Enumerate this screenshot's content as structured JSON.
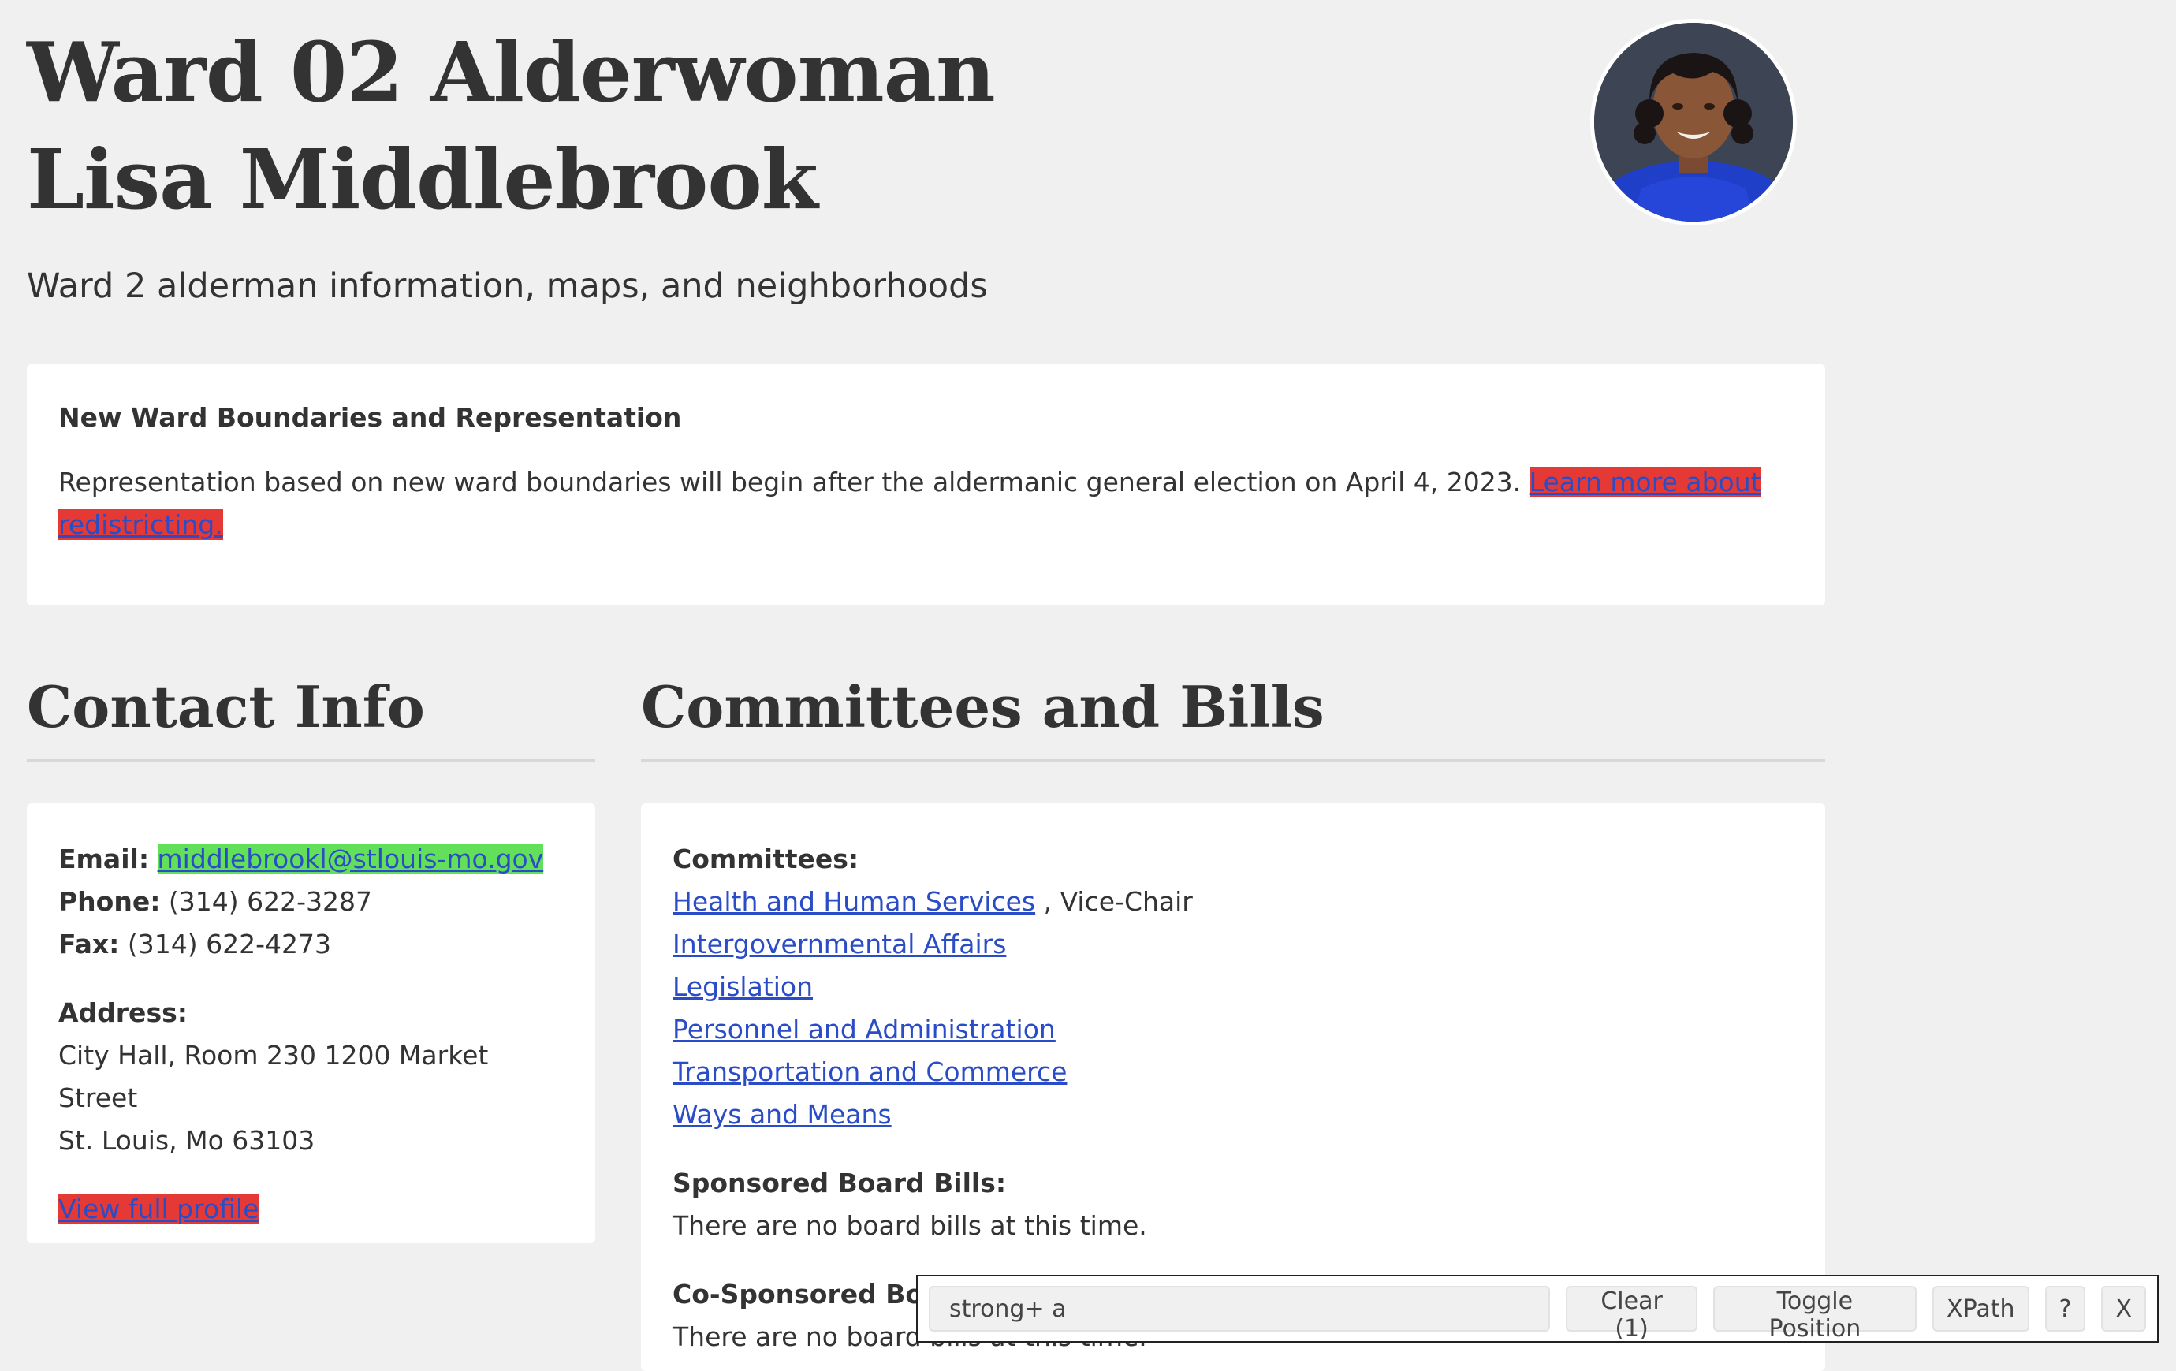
{
  "header": {
    "title": "Ward 02 Alderwoman Lisa Middlebrook",
    "subtitle": "Ward 2 alderman information, maps, and neighborhoods"
  },
  "notice": {
    "title": "New Ward Boundaries and Representation",
    "text": "Representation based on new ward boundaries will begin after the aldermanic general election on April 4, 2023.",
    "link_label": "Learn more about redistricting."
  },
  "contact": {
    "heading": "Contact Info",
    "email_label": "Email:",
    "email": "middlebrookl@stlouis-mo.gov",
    "phone_label": "Phone:",
    "phone": "(314) 622-3287",
    "fax_label": "Fax:",
    "fax": "(314) 622-4273",
    "address_label": "Address:",
    "address_line1": "City Hall, Room 230 1200 Market Street",
    "address_line2": "St. Louis, Mo 63103",
    "profile_link": "View full profile"
  },
  "committees": {
    "heading": "Committees and Bills",
    "committees_label": "Committees:",
    "items": [
      {
        "label": "Health and Human Services",
        "role": ", Vice-Chair"
      },
      {
        "label": "Intergovernmental Affairs"
      },
      {
        "label": "Legislation"
      },
      {
        "label": "Personnel and Administration"
      },
      {
        "label": "Transportation and Commerce"
      },
      {
        "label": "Ways and Means"
      }
    ],
    "sponsored_label": "Sponsored Board Bills:",
    "sponsored_text": "There are no board bills at this time.",
    "cosponsored_label": "Co-Sponsored Board Bills:",
    "cosponsored_text": "There are no board bills at this time."
  },
  "finder": {
    "query": "strong+ a",
    "clear_label": "Clear (1)",
    "toggle_label": "Toggle Position",
    "xpath_label": "XPath",
    "help_label": "?",
    "close_label": "X"
  },
  "colors": {
    "link": "#2b4cc7",
    "highlight_red": "#e53935",
    "highlight_green": "#63e05a",
    "background": "#f0f0f0"
  },
  "icons": {
    "avatar": "profile-photo"
  }
}
